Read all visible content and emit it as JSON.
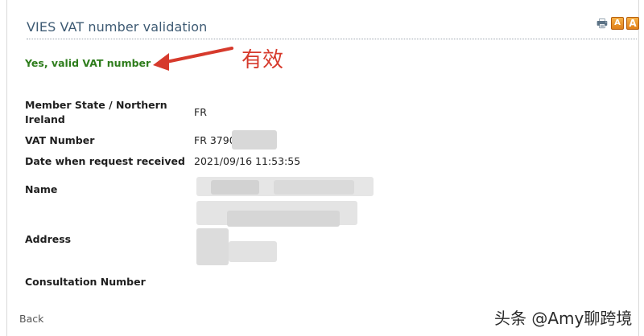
{
  "header": {
    "title": "VIES VAT number validation",
    "icons": [
      "print-icon",
      "font-small-icon",
      "font-large-icon"
    ],
    "icon_glyphs": [
      "🖶",
      "A",
      "A"
    ]
  },
  "result": {
    "status": "Yes, valid VAT number",
    "status_color": "#2e7d1c"
  },
  "annotation": {
    "text": "有效",
    "color": "#d63a2c"
  },
  "fields": {
    "member_state": {
      "label": "Member State / Northern Ireland",
      "value": "FR"
    },
    "vat_number": {
      "label": "VAT Number",
      "value": "FR 3790"
    },
    "date": {
      "label": "Date when request received",
      "value": "2021/09/16 11:53:55"
    },
    "name": {
      "label": "Name",
      "value": ""
    },
    "address": {
      "label": "Address",
      "value": ""
    },
    "consultation": {
      "label": "Consultation Number",
      "value": ""
    }
  },
  "footer": {
    "back_label": "Back"
  },
  "watermark": {
    "text": "头条 @Amy聊跨境"
  }
}
